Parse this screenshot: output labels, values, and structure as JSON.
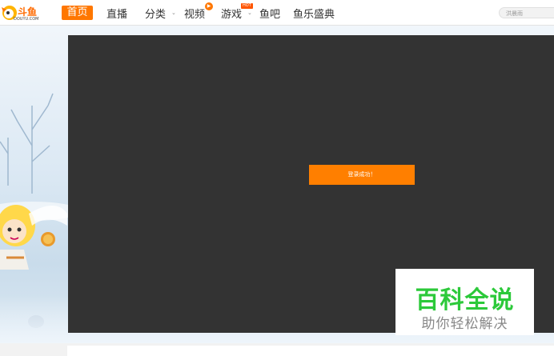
{
  "brand": {
    "logo_text": "斗鱼",
    "logo_sub": "DOUYU.COM"
  },
  "nav": {
    "home": "首页",
    "live": "直播",
    "category": "分类",
    "video": "视频",
    "game": "游戏",
    "game_badge": "HOT",
    "yuba": "鱼吧",
    "festival": "鱼乐盛典"
  },
  "search": {
    "placeholder": "洪晨雨"
  },
  "toast": {
    "message": "登录成功！"
  },
  "watermark": {
    "title": "百科全说",
    "subtitle": "助你轻松解决"
  },
  "colors": {
    "accent": "#ff7700",
    "overlay": "#333333",
    "watermark_green": "#2cc93a"
  }
}
